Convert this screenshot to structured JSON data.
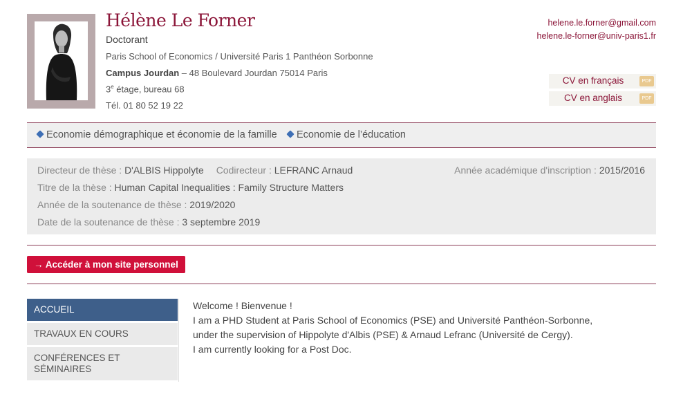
{
  "profile": {
    "name": "Hélène Le Forner",
    "role": "Doctorant",
    "institution": "Paris School of Economics / Université Paris 1 Panthéon Sorbonne",
    "campus": "Campus Jourdan",
    "address": " – 48 Boulevard Jourdan 75014 Paris",
    "floor_num": "3",
    "floor_sup": "e",
    "floor_rest": " étage, bureau 68",
    "phone": "Tél. 01 80 52 19 22"
  },
  "contact": {
    "email_1": "helene.le.forner@gmail.com",
    "email_2": "helene.le-forner@univ-paris1.fr"
  },
  "cv": {
    "french_label": "CV en français",
    "english_label": "CV en anglais",
    "pdf_badge": "PDF"
  },
  "tags": [
    "Economie démographique et économie de la famille",
    "Economie de l’éducation"
  ],
  "thesis": {
    "director_label": "Directeur de thèse : ",
    "director_value": "D'ALBIS Hippolyte",
    "codirector_label": "Codirecteur : ",
    "codirector_value": "LEFRANC Arnaud",
    "year_label": "Année académique d'inscription : ",
    "year_value": "2015/2016",
    "title_label": "Titre de la thèse : ",
    "title_value": "Human Capital Inequalities : Family Structure Matters",
    "defense_year_label": "Année de la soutenance de thèse : ",
    "defense_year_value": "2019/2020",
    "defense_date_label": "Date de la soutenance de thèse : ",
    "defense_date_value": "3 septembre 2019"
  },
  "site_button": "→ Accéder à mon site personnel",
  "nav": {
    "items": [
      "ACCUEIL",
      "TRAVAUX EN COURS",
      "CONFÉRENCES ET SÉMINAIRES"
    ],
    "active_index": 0
  },
  "content": {
    "line_1": "Welcome ! Bienvenue !",
    "line_2": "I am a PHD Student at Paris School of Economics (PSE) and Université Panthéon-Sorbonne,",
    "line_3": "under the supervision of Hippolyte d'Albis (PSE) & Arnaud Lefranc (Université de Cergy).",
    "line_4": "I am currently looking for a Post Doc."
  },
  "colors": {
    "brand": "#8b1538",
    "button": "#d0103a",
    "nav_active": "#3e5f8a",
    "tag_icon": "#3e6fb5"
  }
}
